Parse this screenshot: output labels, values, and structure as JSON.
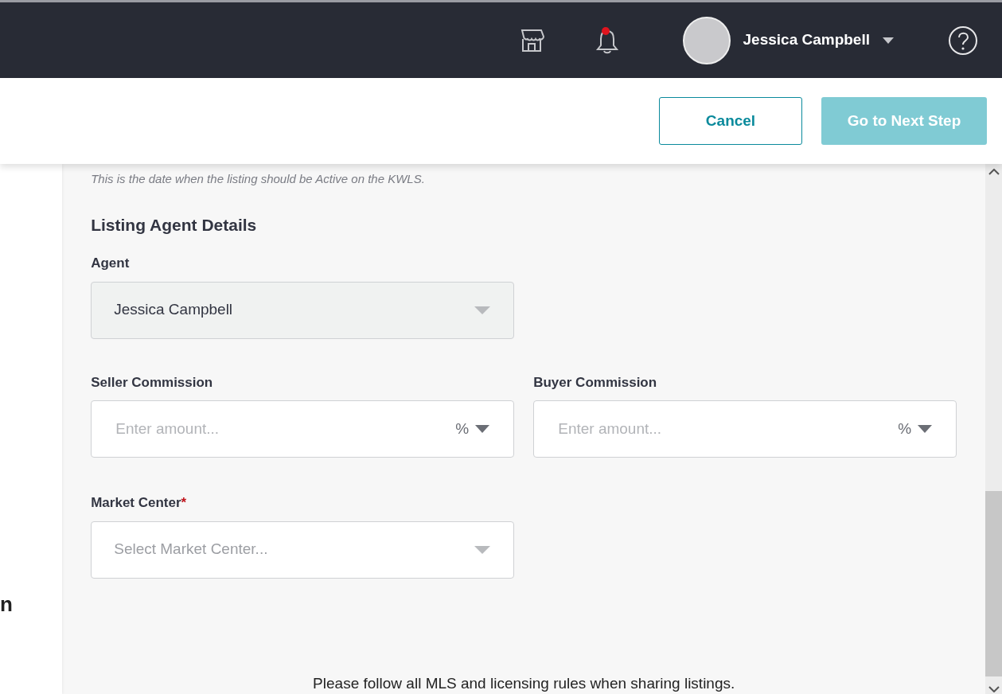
{
  "header": {
    "user_name": "Jessica Campbell",
    "notification_unread": true
  },
  "actions": [
    {
      "label": "Cancel",
      "kind": "outline",
      "disabled": false
    },
    {
      "label": "Go to Next Step",
      "kind": "primary",
      "disabled": true
    }
  ],
  "left_panel": {
    "text": "n"
  },
  "form": {
    "hint": "This is the date when the listing should be Active on the KWLS.",
    "section_title": "Listing Agent Details",
    "agent": {
      "label": "Agent",
      "value": "Jessica Campbell",
      "disabled": true
    },
    "commissions": [
      {
        "label": "Seller Commission",
        "placeholder": "Enter amount...",
        "unit": "%"
      },
      {
        "label": "Buyer Commission",
        "placeholder": "Enter amount...",
        "unit": "%"
      }
    ],
    "market_center": {
      "label": "Market Center",
      "required_mark": "*",
      "placeholder": "Select Market Center...",
      "disabled": false
    },
    "footer_note": "Please follow all MLS and licensing rules when sharing listings."
  }
}
